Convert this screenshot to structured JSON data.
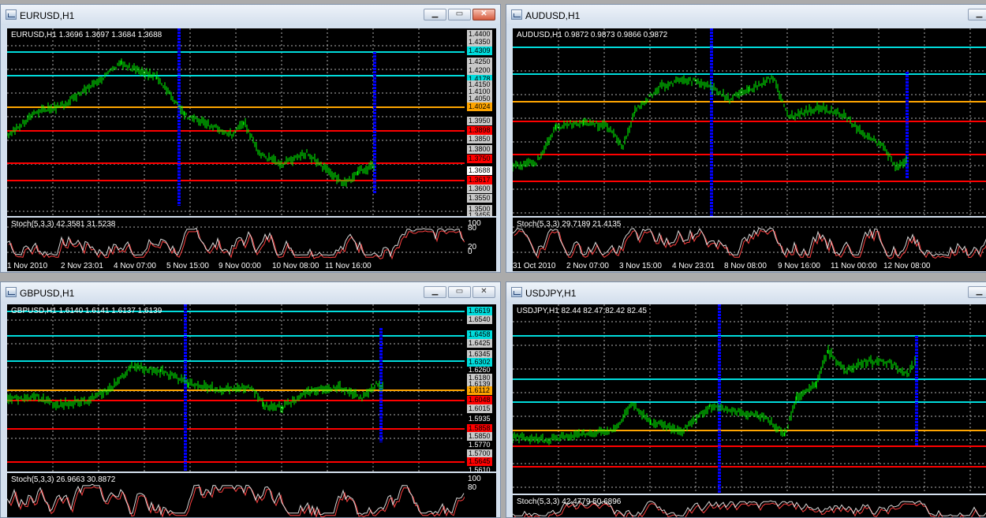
{
  "windows": [
    {
      "title": "EURUSD,H1",
      "close_active": true,
      "quote_line": "EURUSD,H1  1.3696 1.3697 1.3684 1.3688",
      "indicator_line": "Stoch(5,3,3) 42.3581 31.5238",
      "price_labels": [
        {
          "text": "1.4400",
          "kind": "gray"
        },
        {
          "text": "1.4350",
          "kind": "gray"
        },
        {
          "text": "1.4309",
          "kind": "cyan"
        },
        {
          "text": "1.4250",
          "kind": "gray"
        },
        {
          "text": "1.4200",
          "kind": "gray"
        },
        {
          "text": "1.4178",
          "kind": "cyan"
        },
        {
          "text": "1.4150",
          "kind": "gray"
        },
        {
          "text": "1.4100",
          "kind": "gray"
        },
        {
          "text": "1.4050",
          "kind": "gray"
        },
        {
          "text": "1.4024",
          "kind": "orange"
        },
        {
          "text": "1.3950",
          "kind": "gray"
        },
        {
          "text": "1.3898",
          "kind": "red"
        },
        {
          "text": "1.3850",
          "kind": "gray"
        },
        {
          "text": "1.3800",
          "kind": "gray"
        },
        {
          "text": "1.3750",
          "kind": "red"
        },
        {
          "text": "1.3688",
          "kind": "white"
        },
        {
          "text": "1.3617",
          "kind": "red"
        },
        {
          "text": "1.3600",
          "kind": "gray"
        },
        {
          "text": "1.3550",
          "kind": "gray"
        },
        {
          "text": "1.3500",
          "kind": "gray"
        },
        {
          "text": "1.3455",
          "kind": "gray"
        }
      ],
      "stoch_levels": [
        "100",
        "80",
        "20",
        "0"
      ],
      "dates": [
        "1 Nov 2010",
        "2 Nov 23:01",
        "4 Nov 07:00",
        "5 Nov 15:00",
        "9 Nov 00:00",
        "10 Nov 08:00",
        "11 Nov 16:00"
      ]
    },
    {
      "title": "AUDUSD,H1",
      "close_active": false,
      "quote_line": "AUDUSD,H1  0.9872 0.9873 0.9866 0.9872",
      "indicator_line": "Stoch(5,3,3) 29.7189 21.4135",
      "price_labels": [],
      "stoch_levels": [],
      "dates": [
        "31 Oct 2010",
        "2 Nov 07:00",
        "3 Nov 15:00",
        "4 Nov 23:01",
        "8 Nov 08:00",
        "9 Nov 16:00",
        "11 Nov 00:00",
        "12 Nov 08:00"
      ]
    },
    {
      "title": "GBPUSD,H1",
      "close_active": false,
      "quote_line": "GBPUSD,H1  1.6140 1.6141 1.6137 1.6139",
      "indicator_line": "Stoch(5,3,3) 26.9663 30.8872",
      "price_labels": [
        {
          "text": "1.6619",
          "kind": "cyan"
        },
        {
          "text": "1.6540",
          "kind": "gray"
        },
        {
          "text": "1.6458",
          "kind": "cyan"
        },
        {
          "text": "1.6425",
          "kind": "gray"
        },
        {
          "text": "1.6345",
          "kind": "gray"
        },
        {
          "text": "1.6302",
          "kind": "cyan"
        },
        {
          "text": "1.6260",
          "kind": "plain"
        },
        {
          "text": "1.6180",
          "kind": "gray"
        },
        {
          "text": "1.6139",
          "kind": "gray"
        },
        {
          "text": "1.6112",
          "kind": "orange"
        },
        {
          "text": "1.6048",
          "kind": "red"
        },
        {
          "text": "1.6015",
          "kind": "gray"
        },
        {
          "text": "1.5935",
          "kind": "plain"
        },
        {
          "text": "1.5858",
          "kind": "red"
        },
        {
          "text": "1.5850",
          "kind": "gray"
        },
        {
          "text": "1.5770",
          "kind": "plain"
        },
        {
          "text": "1.5700",
          "kind": "gray"
        },
        {
          "text": "1.5645",
          "kind": "red"
        },
        {
          "text": "1.5610",
          "kind": "plain"
        }
      ],
      "stoch_levels": [
        "100",
        "80"
      ],
      "dates": []
    },
    {
      "title": "USDJPY,H1",
      "close_active": false,
      "quote_line": "USDJPY,H1  82.44 82.47 82.42 82.45",
      "indicator_line": "Stoch(5,3,3) 42.4779 50.6896",
      "price_labels": [],
      "stoch_levels": [],
      "dates": []
    }
  ],
  "colors": {
    "cyan": "#00dcdc",
    "orange": "#ffa500",
    "red": "#ff0000",
    "blue": "#0000ff",
    "candle": "#00ff00",
    "grid": "#b0b0b0"
  }
}
